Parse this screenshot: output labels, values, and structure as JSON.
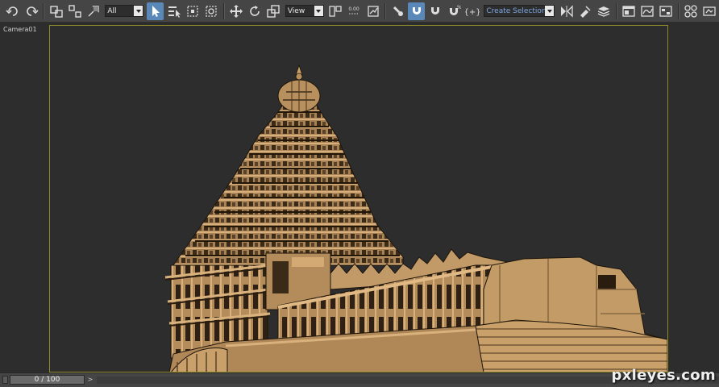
{
  "toolbar": {
    "selection_filter": "All",
    "ref_coord_system": "View",
    "numeric_value": "0.00",
    "named_selection_placeholder": "Create Selection Set",
    "icons": [
      "undo-icon",
      "redo-icon",
      "select-link-icon",
      "unlink-icon",
      "bind-spacewarp-icon",
      "select-object-icon",
      "select-by-name-icon",
      "rect-selection-region-icon",
      "window-crossing-icon",
      "move-icon",
      "rotate-icon",
      "scale-icon",
      "use-pivot-center-icon",
      "select-manipulate-icon",
      "keyboard-shortcut-override-icon",
      "snaps-toggle-icon",
      "angle-snap-icon",
      "percent-snap-icon",
      "spinner-snap-icon",
      "edit-named-selection-icon",
      "mirror-icon",
      "align-icon",
      "layer-manager-icon",
      "graphite-modeling-icon",
      "curve-editor-icon",
      "schematic-view-icon",
      "material-editor-icon",
      "render-setup-icon"
    ]
  },
  "viewport": {
    "label": "Camera01",
    "frame_color": "#8c8a2a",
    "model_color": "#c19a68"
  },
  "timeline": {
    "frame_display": "0 / 100"
  },
  "watermark": "pxleyes.com"
}
